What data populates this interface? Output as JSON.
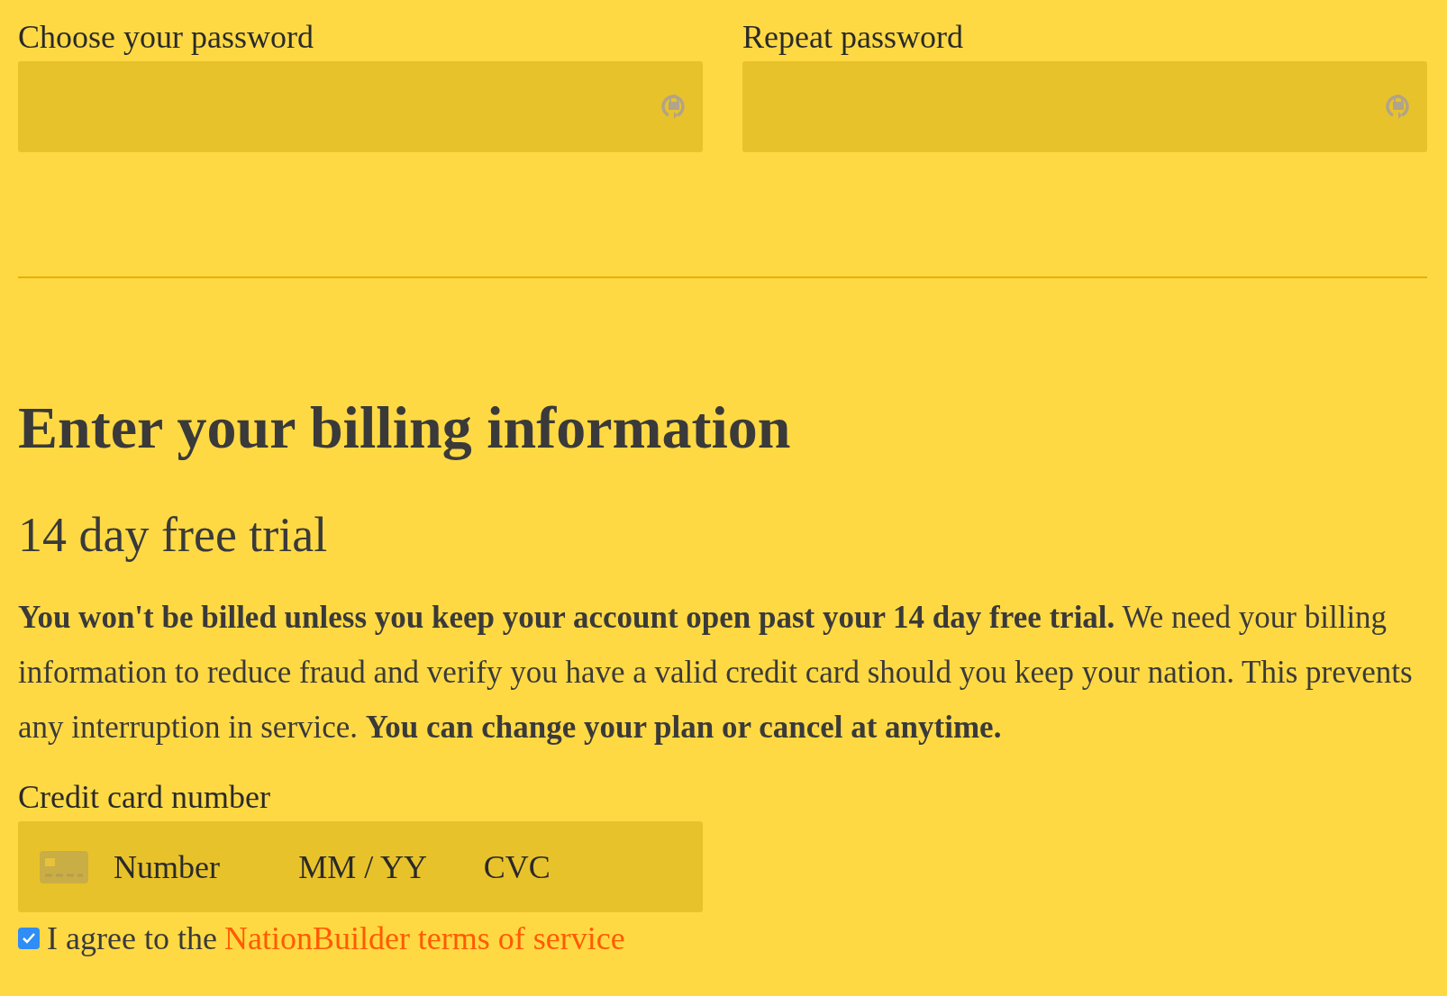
{
  "password_fields": [
    {
      "label": "Choose your password"
    },
    {
      "label": "Repeat password"
    }
  ],
  "billing": {
    "heading": "Enter your billing information",
    "subheading": "14 day free trial",
    "description": "**You won't be billed unless you keep your account open past your 14 day free trial.** We need your billing information to reduce fraud and verify you have a valid credit card should you keep your nation. This prevents any interruption in service. **You can change your plan or cancel at anytime.**",
    "card": {
      "label": "Credit card number",
      "number_placeholder": "Number",
      "expiry_placeholder": "MM / YY",
      "cvc_placeholder": "CVC"
    },
    "terms": {
      "checked": true,
      "text": "I agree to the",
      "link": "NationBuilder terms of service"
    }
  }
}
